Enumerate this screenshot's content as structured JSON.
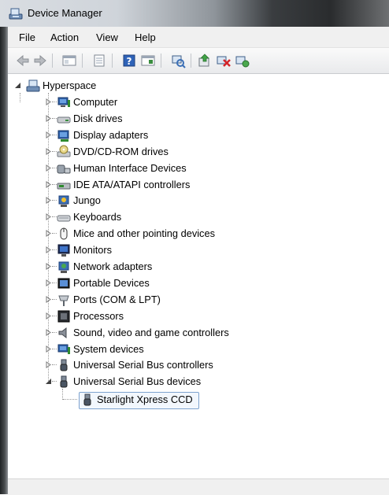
{
  "window": {
    "title": "Device Manager"
  },
  "menu": [
    "File",
    "Action",
    "View",
    "Help"
  ],
  "tree": {
    "root": {
      "label": "Hyperspace",
      "icon": "computer-root-icon"
    },
    "items": [
      {
        "label": "Computer",
        "icon": "computer-icon"
      },
      {
        "label": "Disk drives",
        "icon": "disk-drive-icon"
      },
      {
        "label": "Display adapters",
        "icon": "display-adapter-icon"
      },
      {
        "label": "DVD/CD-ROM drives",
        "icon": "dvd-drive-icon"
      },
      {
        "label": "Human Interface Devices",
        "icon": "hid-icon"
      },
      {
        "label": "IDE ATA/ATAPI controllers",
        "icon": "ide-controller-icon"
      },
      {
        "label": "Jungo",
        "icon": "jungo-icon"
      },
      {
        "label": "Keyboards",
        "icon": "keyboard-icon"
      },
      {
        "label": "Mice and other pointing devices",
        "icon": "mouse-icon"
      },
      {
        "label": "Monitors",
        "icon": "monitor-icon"
      },
      {
        "label": "Network adapters",
        "icon": "network-adapter-icon"
      },
      {
        "label": "Portable Devices",
        "icon": "portable-device-icon"
      },
      {
        "label": "Ports (COM & LPT)",
        "icon": "port-icon"
      },
      {
        "label": "Processors",
        "icon": "processor-icon"
      },
      {
        "label": "Sound, video and game controllers",
        "icon": "sound-icon"
      },
      {
        "label": "System devices",
        "icon": "system-device-icon"
      },
      {
        "label": "Universal Serial Bus controllers",
        "icon": "usb-icon"
      },
      {
        "label": "Universal Serial Bus devices",
        "icon": "usb-icon"
      }
    ],
    "child": {
      "label": "Starlight Xpress CCD",
      "icon": "usb-icon"
    }
  }
}
